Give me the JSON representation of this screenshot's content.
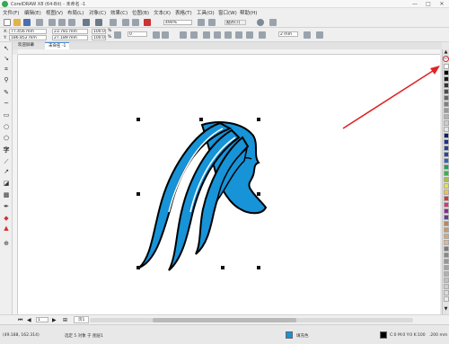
{
  "titlebar": {
    "title": "CorelDRAW X8 (64-Bit) - 未命名 -1",
    "min": "—",
    "max": "□",
    "close": "✕"
  },
  "menu": [
    "文件(F)",
    "编辑(E)",
    "视图(V)",
    "布局(L)",
    "对象(C)",
    "效果(C)",
    "位图(B)",
    "文本(X)",
    "表格(T)",
    "工具(O)",
    "窗口(W)",
    "帮助(H)"
  ],
  "toolbar": {
    "zoom": "490%",
    "snap_label": "贴齐(T)",
    "x": "77.456 mm",
    "y": "186.852 mm",
    "w": "23.781 mm",
    "h": "27.189 mm",
    "scale_w": "100.0",
    "scale_h": "100.0",
    "pct": "%",
    "angle": "0",
    "outline": "2 mm"
  },
  "tabs": [
    "欢迎屏幕",
    "未命名 -1"
  ],
  "pagebar": {
    "page_label": "页1",
    "page_count": "1"
  },
  "status": {
    "coords": "(49.188, 162.314)",
    "selection": "选定 5 对象 于 图层1",
    "fill_label": "填充色",
    "cmyk": "C:0 M:0 Y:0 K:100",
    "width": ".200 mm"
  },
  "colors": {
    "hair": "#1793d8",
    "arrow": "#e02424",
    "palette": [
      "#ffffff",
      "#000000",
      "#1a1a1a",
      "#333333",
      "#4d4d4d",
      "#666666",
      "#808080",
      "#999999",
      "#b3b3b3",
      "#cccccc",
      "#e5e5e5",
      "#0a1f63",
      "#1f2f8a",
      "#2a3e9e",
      "#1c4aa8",
      "#3a5fbf",
      "#18a54d",
      "#37b34a",
      "#a3c43c",
      "#e7e04d",
      "#f0c33a",
      "#d9363e",
      "#e0317a",
      "#8f2c91",
      "#5f3f8f",
      "#b88a5c",
      "#c59a6f",
      "#d2a979",
      "#e0b98a",
      "#7a7a7a",
      "#888888",
      "#969696",
      "#a4a4a4",
      "#b2b2b2",
      "#c0c0c0",
      "#cecece",
      "#dcdcdc",
      "#eaeaea"
    ]
  }
}
